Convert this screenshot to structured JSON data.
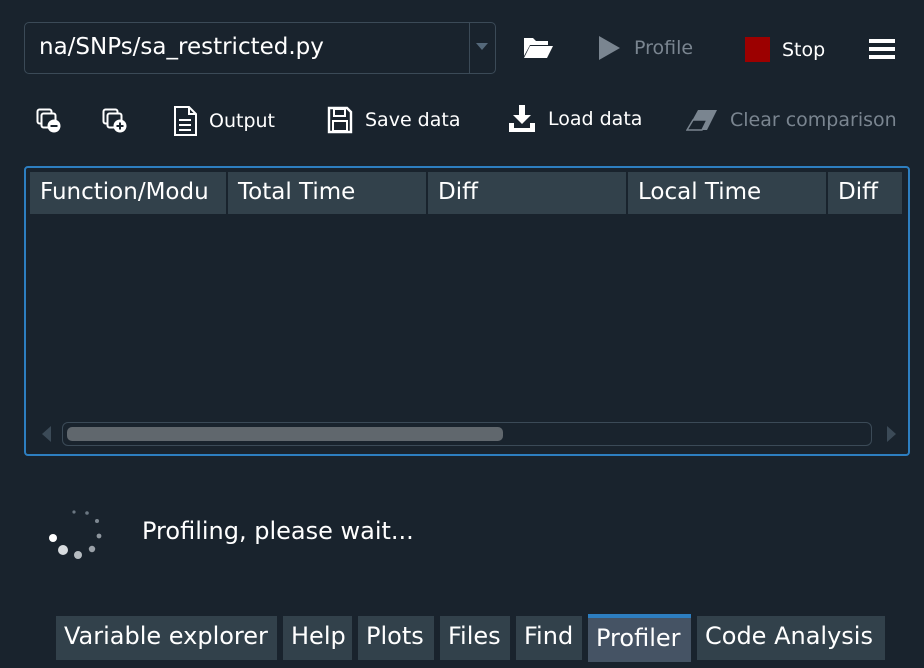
{
  "file_selector": {
    "path": "na/SNPs/sa_restricted.py"
  },
  "toolbar_top": {
    "open_icon": "folder-open-icon",
    "profile_label": "Profile",
    "stop_label": "Stop",
    "stop_color": "#9c0000",
    "menu_icon": "hamburger-menu-icon"
  },
  "toolbar_secondary": {
    "collapse_icon": "collapse-tree-icon",
    "expand_icon": "expand-tree-icon",
    "output_label": "Output",
    "save_label": "Save data",
    "load_label": "Load data",
    "clear_label": "Clear comparison"
  },
  "table": {
    "columns": [
      "Function/Modu",
      "Total Time",
      "Diff",
      "Local Time",
      "Diff"
    ],
    "rows": [],
    "scroll_fraction": 0.545
  },
  "status": {
    "message": "Profiling, please wait..."
  },
  "tabs": [
    "Variable explorer",
    "Help",
    "Plots",
    "Files",
    "Find",
    "Profiler",
    "Code Analysis"
  ],
  "active_tab": "Profiler",
  "colors": {
    "background": "#19232d",
    "accent": "#2d7ec0",
    "header": "#32414b"
  }
}
